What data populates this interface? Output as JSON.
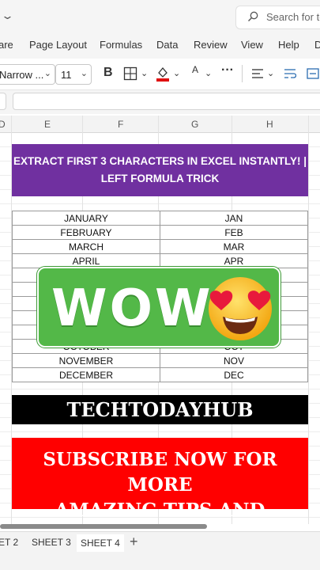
{
  "search": {
    "placeholder": "Search for to"
  },
  "ribbon": {
    "tabs": [
      "are",
      "Page Layout",
      "Formulas",
      "Data",
      "Review",
      "View",
      "Help",
      "D"
    ]
  },
  "toolbar": {
    "font_name": "Narrow ...",
    "font_size": "11",
    "bold_label": "B",
    "font_color_label": "A",
    "more_label": "···"
  },
  "columns": [
    "D",
    "E",
    "F",
    "G",
    "H"
  ],
  "banner": {
    "line1": "EXTRACT FIRST 3 CHARACTERS IN EXCEL INSTANTLY! |",
    "line2": "LEFT FORMULA TRICK"
  },
  "table": {
    "rows": [
      [
        "JANUARY",
        "JAN"
      ],
      [
        "FEBRUARY",
        "FEB"
      ],
      [
        "MARCH",
        "MAR"
      ],
      [
        "APRIL",
        "APR"
      ],
      [
        "",
        ""
      ],
      [
        "",
        ""
      ],
      [
        "",
        ""
      ],
      [
        "",
        ""
      ],
      [
        "",
        ""
      ],
      [
        "OCTOBER",
        "OCT"
      ],
      [
        "NOVEMBER",
        "NOV"
      ],
      [
        "DECEMBER",
        "DEC"
      ]
    ]
  },
  "sticker": {
    "text": "WOW",
    "emoji": "heart-eyes-emoji"
  },
  "brand": {
    "text": "TECHTODAYHUB"
  },
  "subscribe": {
    "line1": "SUBSCRIBE NOW FOR MORE",
    "line2": "AMAZING TIPS AND TRICKS!"
  },
  "sheets": {
    "tabs": [
      "ET 2",
      "SHEET 3",
      "SHEET 4"
    ],
    "active": "SHEET 4",
    "add_label": "+"
  },
  "colors": {
    "banner": "#7030a0",
    "sticker": "#53b848",
    "subscribe": "#ff0000",
    "brand": "#000000"
  }
}
